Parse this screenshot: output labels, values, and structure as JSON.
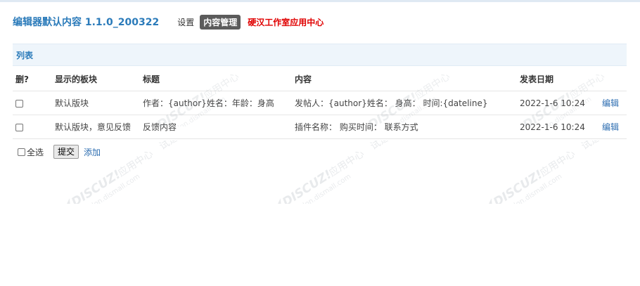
{
  "header": {
    "title": "编辑器默认内容 1.1.0_200322",
    "nav_settings": "设置",
    "nav_content": "内容管理",
    "nav_center": "硬汉工作室应用中心"
  },
  "section": {
    "title": "列表"
  },
  "table": {
    "columns": [
      "删?",
      "显示的板块",
      "标题",
      "内容",
      "发表日期",
      ""
    ],
    "rows": [
      {
        "board": "默认版块",
        "title": "作者：{author}姓名：年龄：身高",
        "content": "发帖人：{author}姓名： 身高： 时间:{dateline}",
        "date": "2022-1-6 10:24",
        "action": "编辑"
      },
      {
        "board": "默认版块，意见反馈",
        "title": "反馈内容",
        "content": "插件名称： 购买时间： 联系方式",
        "date": "2022-1-6 10:24",
        "action": "编辑"
      }
    ]
  },
  "footer": {
    "select_all": "全选",
    "submit": "提交",
    "add": "添加"
  },
  "watermark": {
    "brand": "DISCUZ!",
    "tag": "应用中心",
    "tag2": "试道",
    "domain": "addon.dismall.com"
  },
  "colors": {
    "accent": "#2b7bba",
    "red": "#e00000",
    "section_bg": "#eef5fb"
  }
}
